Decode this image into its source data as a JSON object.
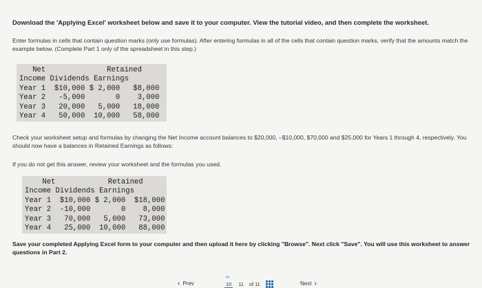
{
  "heading": "Download the 'Applying Excel' worksheet below and save it to your computer. View the tutorial video, and then complete the worksheet.",
  "instruction1": "Enter formulas in cells that contain question marks (only use formulas). After entering formulas in all of the cells that contain question marks, verify that the amounts match the example below. (Complete Part 1 only of the spreadsheet in this step.)",
  "table1": {
    "header1": "   Net              Retained",
    "header2": "Income Dividends Earnings",
    "rows": [
      "Year 1  $10,000 $ 2,000   $8,000",
      "Year 2   -5,000       0    3,000",
      "Year 3   20,000   5,000   18,000",
      "Year 4   50,000  10,000   58,000"
    ]
  },
  "instruction2": "Check your worksheet setup and formulas by changing the Net Income account balances to $20,000, –$10,000, $70,000 and $25,000 for Years 1 through 4, respectively. You should now have a balances in Retained Earnings as follows:",
  "instruction3": "If you do not get this answer, review your worksheet and the formulas you used.",
  "table2": {
    "header1": "    Net            Retained",
    "header2": "Income Dividends Earnings",
    "rows": [
      "Year 1  $10,000 $ 2,000  $18,000",
      "Year 2  -10,000       0    8,000",
      "Year 3   70,000   5,000   73,000",
      "Year 4   25,000  10,000   88,000"
    ]
  },
  "instruction4": "Save your completed Applying Excel form to your computer and then upload it here by clicking \"Browse\". Next click \"Save\". You will use this worksheet to answer questions in Part 2.",
  "nav": {
    "prev_label": "Prev",
    "page_a": "10",
    "page_b": "11",
    "of_label": "of 11",
    "next_label": "Next"
  }
}
